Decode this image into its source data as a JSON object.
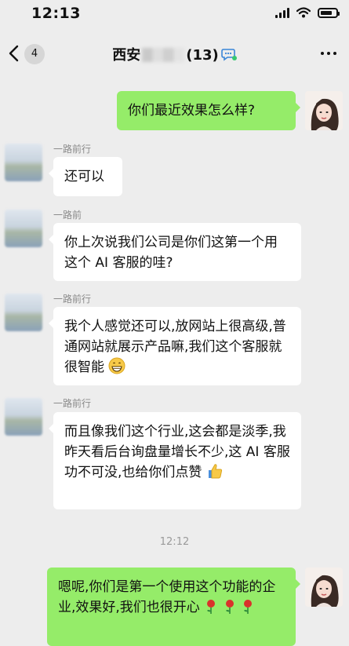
{
  "status_bar": {
    "time": "12:13",
    "battery_level": 0.8
  },
  "nav": {
    "unread_count": "4",
    "title_prefix": "西安",
    "title_suffix": "(13)"
  },
  "messages": [
    {
      "side": "out",
      "text": "你们最近效果怎么样?"
    },
    {
      "side": "in",
      "sender": "一路前行",
      "text": "还可以"
    },
    {
      "side": "in",
      "sender": "一路前",
      "text": "你上次说我们公司是你们这第一个用这个 AI 客服的哇?"
    },
    {
      "side": "in",
      "sender": "一路前行",
      "text": "我个人感觉还可以,放网站上很高级,普通网站就展示产品嘛,我们这个客服就很智能",
      "emoji": "grinning-face-emoji"
    },
    {
      "side": "in",
      "sender": "一路前行",
      "text": "而且像我们这个行业,这会都是淡季,我昨天看后台询盘量增长不少,这 AI 客服功不可没,也给你们点赞",
      "emoji": "thumbs-up-emoji"
    },
    {
      "side": "out",
      "text": "嗯呢,你们是第一个使用这个功能的企业,效果好,我们也很开心",
      "emoji": "rose-emoji"
    }
  ],
  "time_separator": "12:12",
  "colors": {
    "background": "#ededed",
    "out_bubble": "#95ec69",
    "in_bubble": "#ffffff"
  }
}
